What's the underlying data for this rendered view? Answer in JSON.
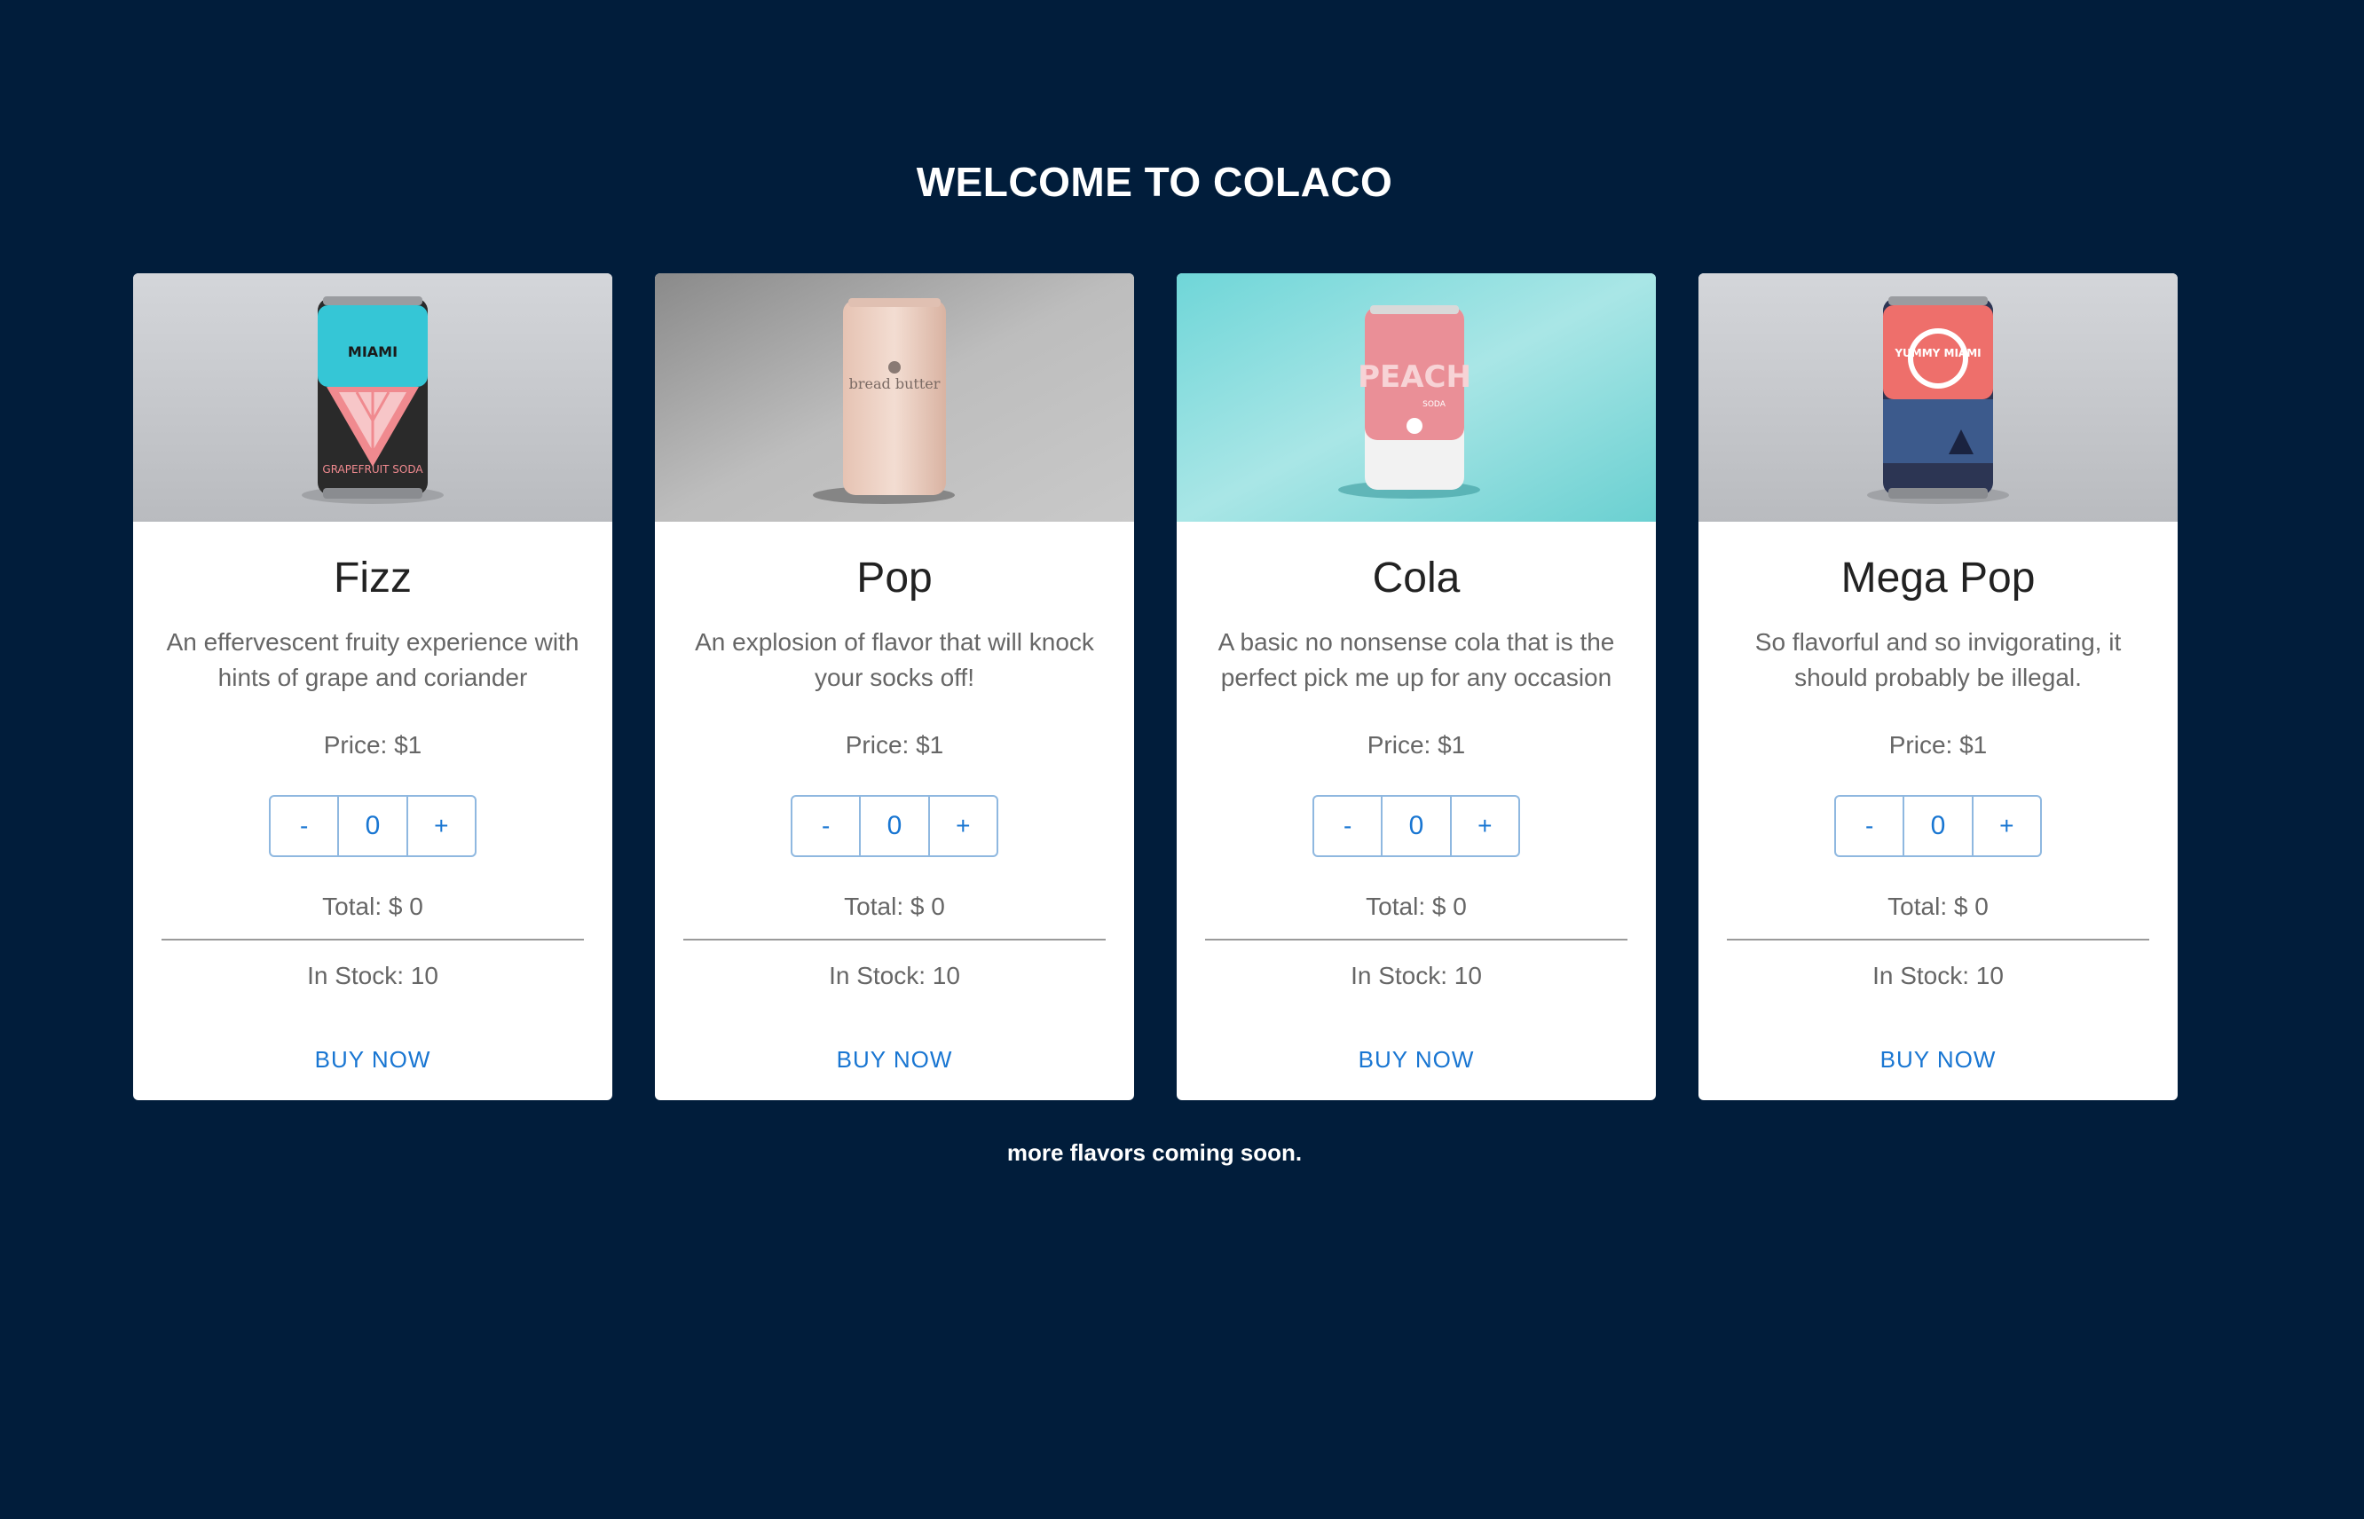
{
  "page": {
    "title": "WELCOME TO COLACO",
    "footer": "more flavors coming soon."
  },
  "colors": {
    "background": "#011d3b",
    "accent": "#1976d2"
  },
  "products": [
    {
      "name": "Fizz",
      "description": "An effervescent fruity experience with hints of grape and coriander",
      "price": "Price: $1",
      "quantity": "0",
      "total": "Total: $ 0",
      "stock": "In Stock: 10",
      "buy_label": "BUY NOW",
      "decrement_label": "-",
      "increment_label": "+",
      "image": {
        "can_label": "MIAMI",
        "can_sublabel": "GRAPEFRUIT SODA"
      }
    },
    {
      "name": "Pop",
      "description": "An explosion of flavor that will knock your socks off!",
      "price": "Price: $1",
      "quantity": "0",
      "total": "Total: $ 0",
      "stock": "In Stock: 10",
      "buy_label": "BUY NOW",
      "decrement_label": "-",
      "increment_label": "+",
      "image": {
        "can_label": "bread butter",
        "can_sublabel": ""
      }
    },
    {
      "name": "Cola",
      "description": "A basic no nonsense cola that is the perfect pick me up for any occasion",
      "price": "Price: $1",
      "quantity": "0",
      "total": "Total: $ 0",
      "stock": "In Stock: 10",
      "buy_label": "BUY NOW",
      "decrement_label": "-",
      "increment_label": "+",
      "image": {
        "can_label": "PEACH",
        "can_sublabel": "SODA"
      }
    },
    {
      "name": "Mega Pop",
      "description": "So flavorful and so invigorating, it should probably be illegal.",
      "price": "Price: $1",
      "quantity": "0",
      "total": "Total: $ 0",
      "stock": "In Stock: 10",
      "buy_label": "BUY NOW",
      "decrement_label": "-",
      "increment_label": "+",
      "image": {
        "can_label": "YUMMY MIAMI",
        "can_sublabel": ""
      }
    }
  ]
}
